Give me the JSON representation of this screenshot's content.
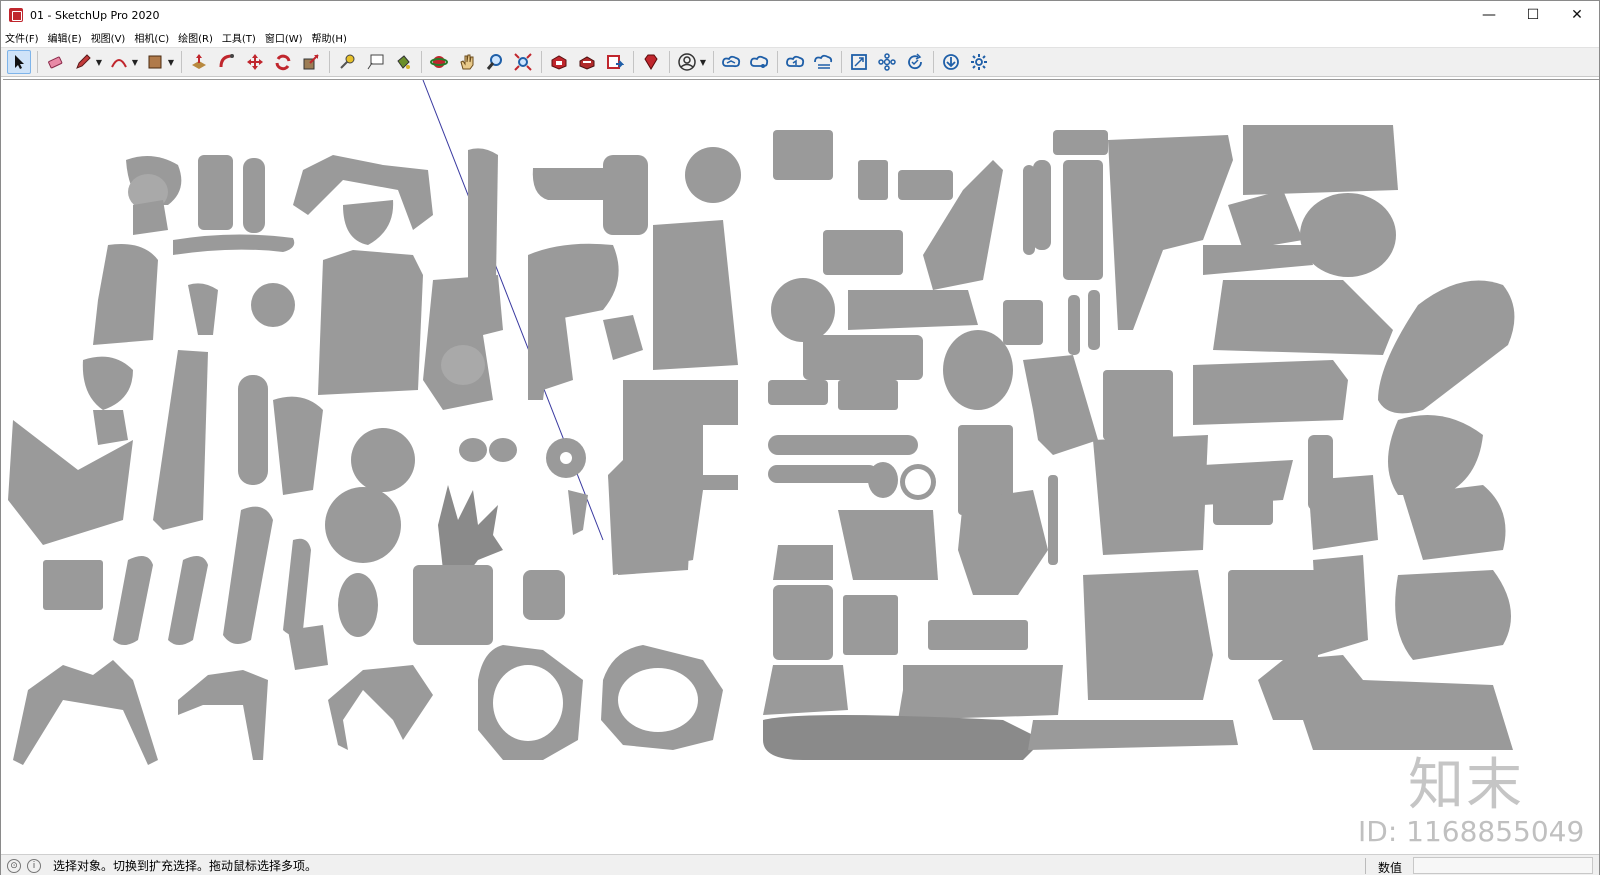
{
  "window": {
    "title": "01 - SketchUp Pro 2020",
    "minimize": "—",
    "maximize": "☐",
    "close": "✕"
  },
  "menu": [
    "文件(F)",
    "编辑(E)",
    "视图(V)",
    "相机(C)",
    "绘图(R)",
    "工具(T)",
    "窗口(W)",
    "帮助(H)"
  ],
  "toolbar": {
    "groups": [
      [
        "select-icon"
      ],
      [
        "eraser-icon",
        "pencil-icon",
        "arc-icon",
        "rectangle-icon"
      ],
      [
        "push-pull-icon",
        "follow-me-icon",
        "move-icon",
        "rotate-icon",
        "scale-icon"
      ],
      [
        "tape-measure-icon",
        "text-icon",
        "paint-bucket-icon"
      ],
      [
        "orbit-icon",
        "pan-icon",
        "zoom-icon",
        "zoom-extents-icon"
      ],
      [
        "3d-warehouse-icon",
        "extension-warehouse-icon",
        "send-to-layout-icon"
      ],
      [
        "ruby-console-icon"
      ],
      [
        "account-icon"
      ],
      [
        "trimble-connect-icon",
        "cloud-share-icon",
        "cloud-sync-icon",
        "cloud-stack-icon"
      ],
      [
        "fit-view-icon",
        "components-icon",
        "refresh-icon",
        "import-icon",
        "settings-icon"
      ]
    ],
    "colors": {
      "accent": "#cfe3f8",
      "red": "#c0262d",
      "blue": "#1f5fa8"
    }
  },
  "viewport": {
    "watermark_logo": "知末",
    "watermark_id": "ID: 1168855049"
  },
  "status": {
    "message": "选择对象。切换到扩充选择。拖动鼠标选择多项。",
    "measurements_label": "数值",
    "measurements_value": ""
  }
}
